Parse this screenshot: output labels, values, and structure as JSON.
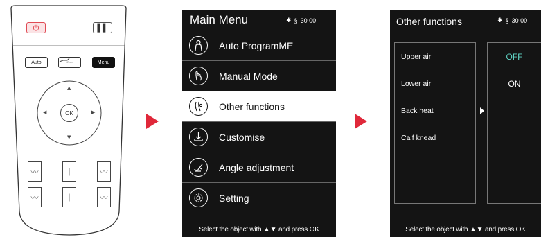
{
  "remote": {
    "auto_label": "Auto",
    "zero_label": "Zero",
    "menu_label": "Menu",
    "ok_label": "OK"
  },
  "main_menu": {
    "title": "Main Menu",
    "status": "30 00",
    "items": [
      {
        "label": "Auto ProgramME",
        "icon": "body-icon"
      },
      {
        "label": "Manual Mode",
        "icon": "hand-icon"
      },
      {
        "label": "Other functions",
        "icon": "leg-massage-icon",
        "selected": true
      },
      {
        "label": "Customise",
        "icon": "download-icon"
      },
      {
        "label": "Angle adjustment",
        "icon": "recline-chair-icon"
      },
      {
        "label": "Setting",
        "icon": "gear-icon"
      }
    ],
    "footer": "Select the object with ▲▼ and press OK"
  },
  "other_functions": {
    "title": "Other functions",
    "status": "30 00",
    "options": [
      "Upper air",
      "Lower air",
      "Back heat",
      "Calf knead"
    ],
    "values": [
      "OFF",
      "ON"
    ],
    "footer": "Select the object with ▲▼ and press OK"
  },
  "colors": {
    "accent_red": "#e0283a",
    "screen_bg": "#141414",
    "off_teal": "#5fd3c4"
  }
}
